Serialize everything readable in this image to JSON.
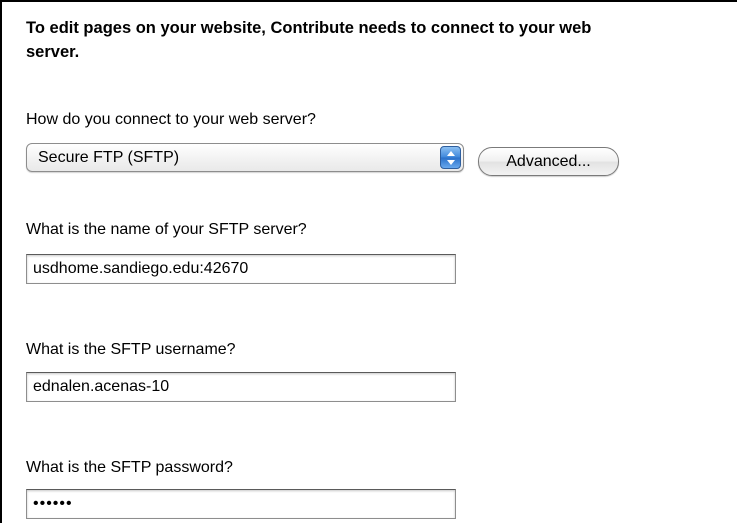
{
  "intro": {
    "line1": "To edit pages on your website, Contribute needs to connect to your web",
    "line2": "server."
  },
  "connection": {
    "question": "How do you connect to your web server?",
    "selected_method": "Secure FTP (SFTP)",
    "advanced_label": "Advanced..."
  },
  "server": {
    "question": "What is the name of your SFTP server?",
    "value": "usdhome.sandiego.edu:42670"
  },
  "username": {
    "question": "What is the SFTP username?",
    "value": "ednalen.acenas-10"
  },
  "password": {
    "question": "What is the SFTP password?",
    "masked_value": "••••••"
  },
  "colors": {
    "select_arrow_blue": "#3d87db",
    "border": "#000000"
  }
}
